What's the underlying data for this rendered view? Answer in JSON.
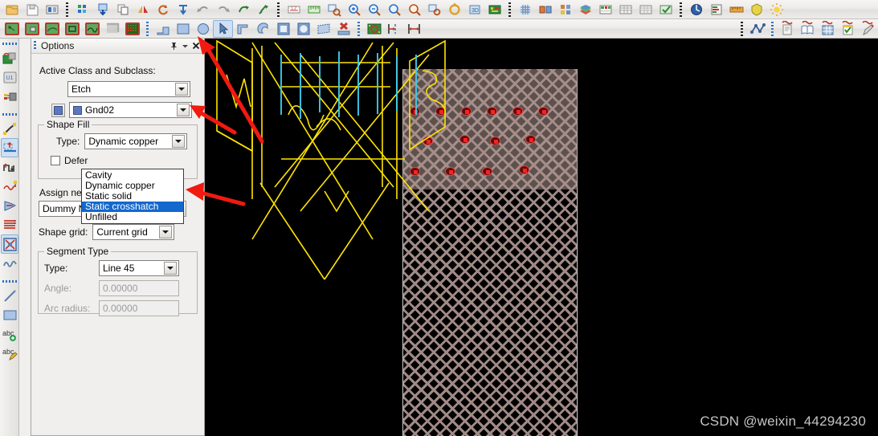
{
  "app": {
    "watermark": "CSDN @weixin_44294230"
  },
  "toolbar_top": {
    "row1": [
      {
        "name": "open-file-icon",
        "glyph": "folder"
      },
      {
        "name": "save-file-icon",
        "glyph": "save"
      },
      {
        "name": "plot-setup-icon",
        "glyph": "plot"
      },
      {
        "name": "color-visibility-icon",
        "glyph": "colorvis"
      },
      {
        "name": "import-logic-icon",
        "glyph": "import"
      },
      {
        "name": "copy-icon",
        "glyph": "copy"
      },
      {
        "name": "mirror-icon",
        "glyph": "mirror"
      },
      {
        "name": "rotate-icon",
        "glyph": "rotate"
      },
      {
        "name": "spread-icon",
        "glyph": "spread"
      },
      {
        "name": "undo-icon",
        "glyph": "undo"
      },
      {
        "name": "redo-icon",
        "glyph": "redo"
      },
      {
        "name": "pan-icon",
        "glyph": "pan"
      },
      {
        "name": "pin-icon",
        "glyph": "pin"
      },
      {
        "name": "dimension-icon",
        "glyph": "dimension"
      },
      {
        "name": "measure-icon",
        "glyph": "measure"
      },
      {
        "name": "zoom-fit-icon",
        "glyph": "zoomfit"
      },
      {
        "name": "zoom-in-icon",
        "glyph": "zoomin"
      },
      {
        "name": "zoom-out-icon",
        "glyph": "zoomout"
      },
      {
        "name": "zoom-by-points-icon",
        "glyph": "zoompts"
      },
      {
        "name": "zoom-world-icon",
        "glyph": "zoomworld"
      },
      {
        "name": "zoom-previous-icon",
        "glyph": "zoomprev"
      },
      {
        "name": "zoom-center-icon",
        "glyph": "zoomcenter"
      },
      {
        "name": "refresh-3d-icon",
        "glyph": "threed"
      },
      {
        "name": "board-geometry-icon",
        "glyph": "board"
      },
      {
        "name": "grid-toggle-icon",
        "glyph": "grid"
      },
      {
        "name": "layer-pair-icon",
        "glyph": "layerpair"
      },
      {
        "name": "subclass-icon",
        "glyph": "subclass"
      },
      {
        "name": "stackup-icon",
        "glyph": "stackup"
      },
      {
        "name": "constraint-manager-icon",
        "glyph": "cmgr"
      },
      {
        "name": "spreadsheet-icon",
        "glyph": "sheet"
      },
      {
        "name": "table-view-icon",
        "glyph": "table"
      },
      {
        "name": "db-check-icon",
        "glyph": "dbcheck"
      },
      {
        "name": "status-icon",
        "glyph": "status"
      },
      {
        "name": "reports-icon",
        "glyph": "reports"
      },
      {
        "name": "ruler-icon",
        "glyph": "ruler"
      },
      {
        "name": "shield-icon",
        "glyph": "shield"
      },
      {
        "name": "highlight-icon",
        "glyph": "highlight"
      }
    ],
    "row2": [
      {
        "name": "shape-add-rect-icon",
        "glyph": "shaperect"
      },
      {
        "name": "shape-select-icon",
        "glyph": "shapesel"
      },
      {
        "name": "shape-edit-boundary-icon",
        "glyph": "shapeedit"
      },
      {
        "name": "shape-compose-icon",
        "glyph": "shapecompose"
      },
      {
        "name": "shape-decompose-icon",
        "glyph": "shapedecompose"
      },
      {
        "name": "shape-delete-island-icon",
        "glyph": "shapeisland"
      },
      {
        "name": "shape-crosshatch-icon",
        "glyph": "crosshatch"
      },
      {
        "name": "add-line-icon",
        "glyph": "addline"
      },
      {
        "name": "add-rect-icon",
        "glyph": "addrect"
      },
      {
        "name": "add-circle-icon",
        "glyph": "addcircle"
      },
      {
        "name": "select-arrow-icon",
        "glyph": "selarrow"
      },
      {
        "name": "shape-polygon-icon",
        "glyph": "poly"
      },
      {
        "name": "shape-arc-icon",
        "glyph": "arc"
      },
      {
        "name": "shape-square-icon",
        "glyph": "square"
      },
      {
        "name": "shape-round-icon",
        "glyph": "round"
      },
      {
        "name": "shape-slant-icon",
        "glyph": "slant"
      },
      {
        "name": "delete-shape-icon",
        "glyph": "delshape"
      },
      {
        "name": "padstack-icon",
        "glyph": "padstack"
      },
      {
        "name": "dimension-linear-icon",
        "glyph": "dimlin"
      },
      {
        "name": "dimension-datum-icon",
        "glyph": "dimdatum"
      },
      {
        "name": "net-schedule-icon",
        "glyph": "netsched"
      },
      {
        "name": "report-doc-icon",
        "glyph": "reportdoc"
      },
      {
        "name": "library-icon",
        "glyph": "library"
      },
      {
        "name": "parts-list-icon",
        "glyph": "partslist"
      },
      {
        "name": "checklist-icon",
        "glyph": "checklist"
      },
      {
        "name": "pencil-icon",
        "glyph": "pencil"
      }
    ]
  },
  "toolbar_left": {
    "groups": [
      {
        "items": [
          {
            "name": "place-component-icon",
            "glyph": "placecomp"
          },
          {
            "name": "place-refdes-icon",
            "glyph": "refdes"
          },
          {
            "name": "swap-component-icon",
            "glyph": "swapcomp"
          }
        ]
      },
      {
        "items": [
          {
            "name": "add-connect-icon",
            "glyph": "addconnect"
          },
          {
            "name": "slide-icon",
            "glyph": "slide",
            "pressed": true
          },
          {
            "name": "delay-tune-icon",
            "glyph": "delaytune"
          },
          {
            "name": "custom-smooth-icon",
            "glyph": "smooth"
          },
          {
            "name": "fanout-icon",
            "glyph": "fanout"
          },
          {
            "name": "bus-route-icon",
            "glyph": "busroute"
          },
          {
            "name": "net-group-icon",
            "glyph": "netgroup",
            "pressed": true
          },
          {
            "name": "meander-icon",
            "glyph": "meander"
          }
        ]
      },
      {
        "items": [
          {
            "name": "add-line-tool-icon",
            "glyph": "lineTool"
          },
          {
            "name": "add-rectangle-tool-icon",
            "glyph": "rectTool"
          },
          {
            "name": "add-text-icon",
            "glyph": "addtext"
          },
          {
            "name": "edit-text-icon",
            "glyph": "edittext"
          }
        ]
      }
    ]
  },
  "options_panel": {
    "title": "Options",
    "titlebar_buttons": [
      {
        "name": "auto-hide-pin-button",
        "glyph": "pin"
      },
      {
        "name": "panel-menu-button",
        "glyph": "caret"
      },
      {
        "name": "close-panel-button",
        "glyph": "close"
      }
    ],
    "active_class_label": "Active Class and Subclass:",
    "class_value": "Etch",
    "subclass_value": "Gnd02",
    "subclass_color": "#5b77bd",
    "shape_fill": {
      "legend": "Shape Fill",
      "type_label": "Type:",
      "type_value": "Dynamic copper",
      "defer_checkbox_label": "Defer",
      "defer_checked": false,
      "options": [
        {
          "label": "Cavity",
          "selected": false
        },
        {
          "label": "Dynamic copper",
          "selected": false
        },
        {
          "label": "Static solid",
          "selected": false
        },
        {
          "label": "Static crosshatch",
          "selected": true
        },
        {
          "label": "Unfilled",
          "selected": false
        }
      ],
      "highlight_color": "#1368ce"
    },
    "assign_net_label": "Assign net:",
    "assign_net_value": "Dummy Net",
    "assign_net_browse": "...",
    "shape_grid_label": "Shape grid:",
    "shape_grid_value": "Current grid",
    "segment_type": {
      "legend": "Segment Type",
      "type_label": "Type:",
      "type_value": "Line 45",
      "angle_label": "Angle:",
      "angle_value": "0.00000",
      "arc_radius_label": "Arc radius:",
      "arc_radius_value": "0.00000"
    }
  },
  "annotations": {
    "arrow_color": "#f01a10",
    "arrows": [
      {
        "name": "arrow-to-toolbar",
        "from": [
          326,
          176
        ],
        "to": [
          248,
          47
        ]
      },
      {
        "name": "arrow-to-subclass-dropdown",
        "from": [
          290,
          163
        ],
        "to": [
          239,
          133
        ]
      },
      {
        "name": "arrow-to-static-crosshatch",
        "from": [
          300,
          255
        ],
        "to": [
          233,
          236
        ]
      }
    ]
  },
  "canvas": {
    "background": "#000000",
    "crosshatch_color": "#a08a86",
    "trace_color": "#ffe400",
    "via_color": "#3cc8e8",
    "pad_color": "#ff2020"
  }
}
